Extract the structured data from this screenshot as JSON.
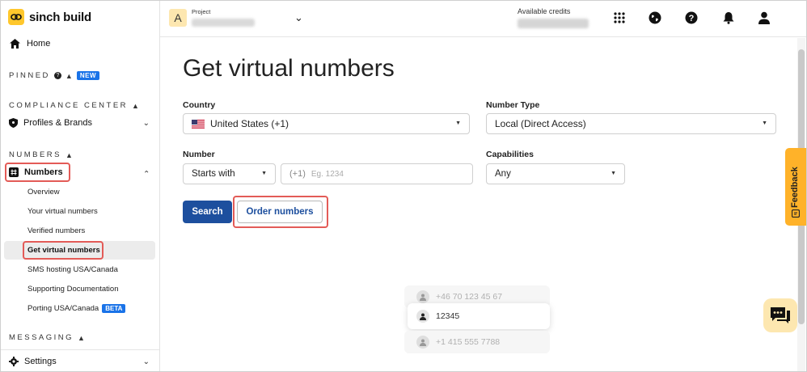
{
  "brand": {
    "name": "sinch build"
  },
  "sidebar": {
    "home": "Home",
    "pinned": {
      "label": "PINNED",
      "badge": "NEW"
    },
    "compliance": {
      "label": "COMPLIANCE CENTER",
      "items": [
        "Profiles & Brands"
      ]
    },
    "numbers": {
      "label": "NUMBERS",
      "title": "Numbers",
      "items": [
        "Overview",
        "Your virtual numbers",
        "Verified numbers",
        "Get virtual numbers",
        "SMS hosting USA/Canada",
        "Supporting Documentation",
        "Porting USA/Canada"
      ],
      "porting_badge": "BETA"
    },
    "messaging": {
      "label": "MESSAGING"
    },
    "settings": "Settings"
  },
  "topbar": {
    "avatar_letter": "A",
    "project_label": "Project",
    "credits_label": "Available credits"
  },
  "main": {
    "title": "Get virtual numbers",
    "country": {
      "label": "Country",
      "value": "United States (+1)"
    },
    "number_type": {
      "label": "Number Type",
      "value": "Local (Direct Access)"
    },
    "number": {
      "label": "Number",
      "mode": "Starts with",
      "prefix": "(+1)",
      "placeholder": "Eg. 1234"
    },
    "capabilities": {
      "label": "Capabilities",
      "value": "Any"
    },
    "search_button": "Search",
    "order_button": "Order numbers",
    "illustration": [
      "+46 70 123 45 67",
      "12345",
      "+1 415 555 7788"
    ]
  },
  "feedback": "Feedback",
  "colors": {
    "accent": "#1d4f9e",
    "brand": "#ffc72c",
    "highlight": "#e35b57",
    "feedback": "#ffb229"
  }
}
